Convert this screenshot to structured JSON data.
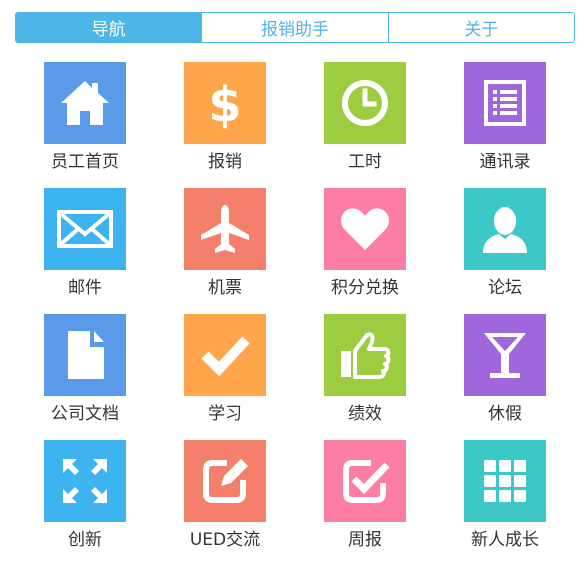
{
  "tabs": [
    {
      "label": "导航",
      "active": true
    },
    {
      "label": "报销助手",
      "active": false
    },
    {
      "label": "关于",
      "active": false
    }
  ],
  "colors": {
    "accent": "#4cb6e8",
    "blue": "#5b9ae8",
    "orange": "#ffa64d",
    "green": "#9ecc41",
    "purple": "#a066dc",
    "red": "#f47f6b",
    "pink": "#fc7fa3",
    "teal": "#3dc8c8",
    "sky": "#3db4ef"
  },
  "apps": [
    {
      "label": "员工首页",
      "icon": "home-icon"
    },
    {
      "label": "报销",
      "icon": "dollar-icon"
    },
    {
      "label": "工时",
      "icon": "clock-icon"
    },
    {
      "label": "通讯录",
      "icon": "contacts-list-icon"
    },
    {
      "label": "邮件",
      "icon": "mail-icon"
    },
    {
      "label": "机票",
      "icon": "airplane-icon"
    },
    {
      "label": "积分兑换",
      "icon": "heart-icon"
    },
    {
      "label": "论坛",
      "icon": "user-icon"
    },
    {
      "label": "公司文档",
      "icon": "document-icon"
    },
    {
      "label": "学习",
      "icon": "checkmark-icon"
    },
    {
      "label": "绩效",
      "icon": "thumbs-up-icon"
    },
    {
      "label": "休假",
      "icon": "cocktail-icon"
    },
    {
      "label": "创新",
      "icon": "expand-icon"
    },
    {
      "label": "UED交流",
      "icon": "edit-icon"
    },
    {
      "label": "周报",
      "icon": "checkbox-icon"
    },
    {
      "label": "新人成长",
      "icon": "grid-icon"
    }
  ]
}
